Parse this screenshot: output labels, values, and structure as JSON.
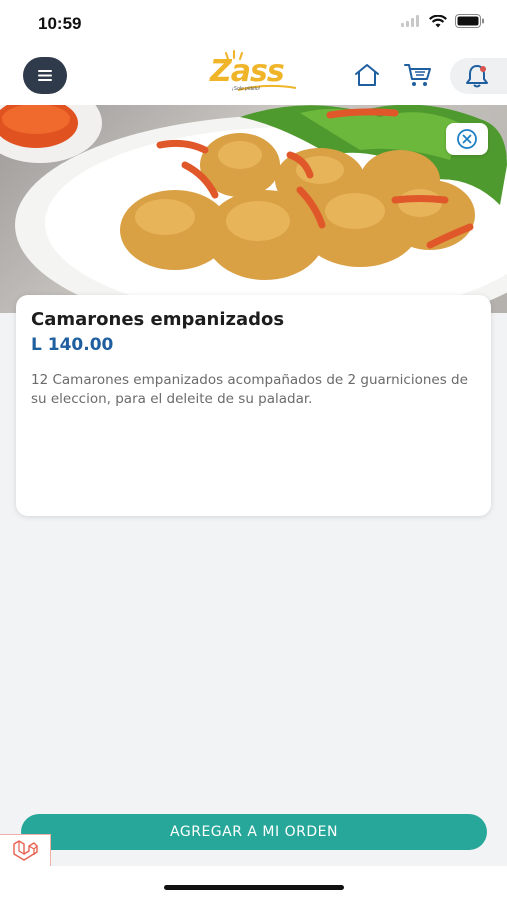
{
  "status_bar": {
    "time": "10:59"
  },
  "header": {
    "logo_text": "Zass",
    "logo_tagline": "¡Solo pídelo!",
    "brand_color": "#f0b428",
    "icons": [
      "menu-icon",
      "home-icon",
      "cart-icon",
      "bell-icon"
    ]
  },
  "product": {
    "name": "Camarones empanizados",
    "price": "L 140.00",
    "description": "12 Camarones empanizados acompañados de 2 guarniciones de su eleccion, para el deleite de su paladar.",
    "price_color": "#1f5fa0"
  },
  "actions": {
    "add_to_order_label": "AGREGAR A MI ORDEN",
    "button_color": "#26a79a"
  }
}
